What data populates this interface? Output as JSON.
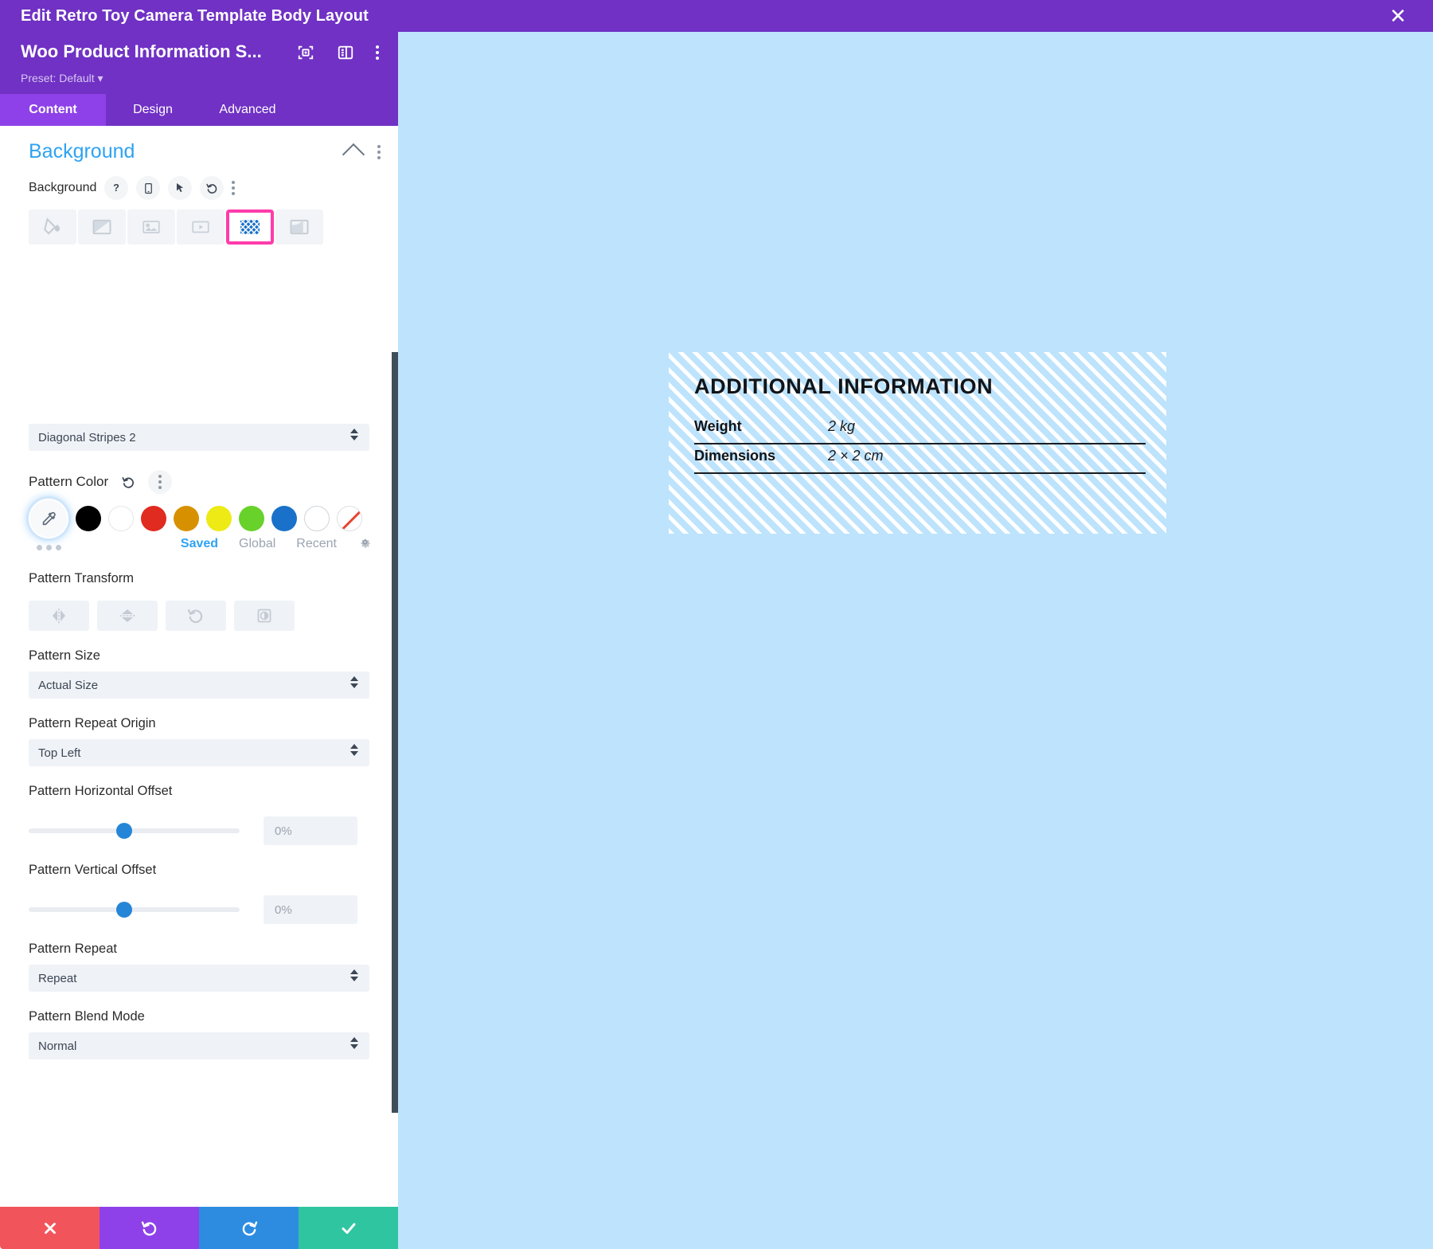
{
  "window": {
    "title": "Edit Retro Toy Camera Template Body Layout",
    "close_icon": "close-icon"
  },
  "panel": {
    "module_title": "Woo Product Information S...",
    "preset": "Preset: Default",
    "header_icons": [
      "focus-target-icon",
      "layout-panel-icon",
      "more-vertical-icon"
    ],
    "tabs": [
      {
        "label": "Content",
        "active": true
      },
      {
        "label": "Design",
        "active": false
      },
      {
        "label": "Advanced",
        "active": false
      }
    ],
    "section": {
      "title": "Background",
      "collapse_icon": "chevron-up-icon",
      "options_icon": "more-vertical-icon"
    },
    "background_row": {
      "label": "Background",
      "icons": [
        "help-icon",
        "responsive-mobile-icon",
        "hover-cursor-icon",
        "reset-icon",
        "more-vertical-icon"
      ]
    },
    "background_types": [
      {
        "name": "background-color",
        "icon": "paint-bucket-icon",
        "selected": false
      },
      {
        "name": "background-gradient",
        "icon": "gradient-icon",
        "selected": false
      },
      {
        "name": "background-image",
        "icon": "image-icon",
        "selected": false
      },
      {
        "name": "background-video",
        "icon": "video-icon",
        "selected": false
      },
      {
        "name": "background-pattern",
        "icon": "pattern-icon",
        "selected": true
      },
      {
        "name": "background-mask",
        "icon": "mask-icon",
        "selected": false
      }
    ],
    "pattern_style": {
      "value": "Diagonal Stripes 2"
    },
    "pattern_color": {
      "label": "Pattern Color",
      "reset_icon": "reset-icon",
      "options_icon": "more-vertical-icon",
      "swatches": [
        {
          "name": "color-picker",
          "color": "#f7f9fb",
          "icon": "eyedropper-icon",
          "selected": true
        },
        {
          "name": "swatch-black",
          "color": "#000000"
        },
        {
          "name": "swatch-white",
          "color": "#ffffff"
        },
        {
          "name": "swatch-red",
          "color": "#e02b20"
        },
        {
          "name": "swatch-orange",
          "color": "#d79100"
        },
        {
          "name": "swatch-yellow",
          "color": "#edea15"
        },
        {
          "name": "swatch-green",
          "color": "#68d12a"
        },
        {
          "name": "swatch-blue",
          "color": "#1a71c9"
        },
        {
          "name": "swatch-plain-white",
          "color": "#ffffff"
        },
        {
          "name": "swatch-transparent",
          "color": "none"
        }
      ],
      "more_icon": "more-horizontal-icon",
      "palette_tabs": [
        {
          "label": "Saved",
          "active": true
        },
        {
          "label": "Global",
          "active": false
        },
        {
          "label": "Recent",
          "active": false
        }
      ],
      "settings_icon": "gear-icon"
    },
    "pattern_transform": {
      "label": "Pattern Transform",
      "buttons": [
        {
          "name": "flip-horizontal-button",
          "icon": "flip-horizontal-icon"
        },
        {
          "name": "flip-vertical-button",
          "icon": "flip-vertical-icon"
        },
        {
          "name": "rotate-button",
          "icon": "rotate-icon"
        },
        {
          "name": "invert-button",
          "icon": "invert-icon"
        }
      ]
    },
    "pattern_size": {
      "label": "Pattern Size",
      "value": "Actual Size"
    },
    "pattern_repeat_origin": {
      "label": "Pattern Repeat Origin",
      "value": "Top Left"
    },
    "pattern_horizontal_offset": {
      "label": "Pattern Horizontal Offset",
      "value": "0%"
    },
    "pattern_vertical_offset": {
      "label": "Pattern Vertical Offset",
      "value": "0%"
    },
    "pattern_repeat": {
      "label": "Pattern Repeat",
      "value": "Repeat"
    },
    "pattern_blend_mode": {
      "label": "Pattern Blend Mode",
      "value": "Normal"
    },
    "actions": [
      {
        "name": "cancel-button",
        "icon": "close-icon",
        "color": "#f2545b"
      },
      {
        "name": "undo-button",
        "icon": "undo-icon",
        "color": "#8e41e8"
      },
      {
        "name": "redo-button",
        "icon": "redo-icon",
        "color": "#2d8ce0"
      },
      {
        "name": "save-button",
        "icon": "check-icon",
        "color": "#2fc5a0"
      }
    ]
  },
  "canvas": {
    "background_color": "#bee3fc",
    "module": {
      "heading": "ADDITIONAL INFORMATION",
      "rows": [
        {
          "key": "Weight",
          "value": "2 kg"
        },
        {
          "key": "Dimensions",
          "value": "2 × 2 cm"
        }
      ]
    }
  }
}
